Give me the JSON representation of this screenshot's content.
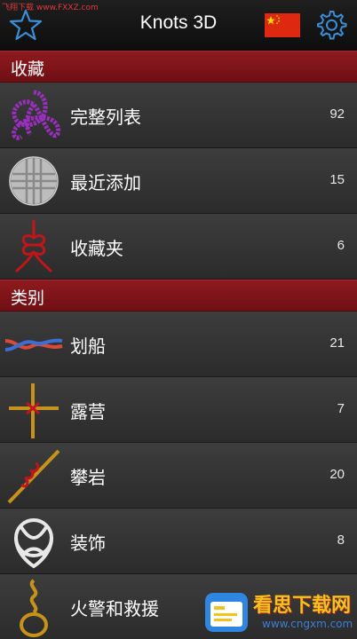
{
  "watermark": {
    "top_text": "飞翔下载 www.FXXZ.com",
    "badge_big": "看思下载网",
    "badge_small": "www.cngxm.com"
  },
  "header": {
    "title": "Knots 3D",
    "left_icon": "star-icon",
    "flag_icon": "china-flag-icon",
    "right_icon": "gear-icon",
    "accent": "#3a8fd8"
  },
  "sections": [
    {
      "title": "收藏",
      "items": [
        {
          "label": "完整列表",
          "count": "92",
          "icon": "purple-trefoil-knot-icon"
        },
        {
          "label": "最近添加",
          "count": "15",
          "icon": "monkey-fist-knot-icon"
        },
        {
          "label": "收藏夹",
          "count": "6",
          "icon": "red-chinese-knot-icon"
        }
      ]
    },
    {
      "title": "类别",
      "items": [
        {
          "label": "划船",
          "count": "21",
          "icon": "boating-knot-icon"
        },
        {
          "label": "露营",
          "count": "7",
          "icon": "camping-lashing-icon"
        },
        {
          "label": "攀岩",
          "count": "20",
          "icon": "climbing-knot-icon"
        },
        {
          "label": "装饰",
          "count": "8",
          "icon": "decorative-knot-icon"
        },
        {
          "label": "火警和救援",
          "count": "",
          "icon": "rescue-knot-icon"
        }
      ]
    }
  ],
  "colors": {
    "section_bg": "#7f151a",
    "row_bg": "#333333",
    "header_bg": "#151515"
  }
}
